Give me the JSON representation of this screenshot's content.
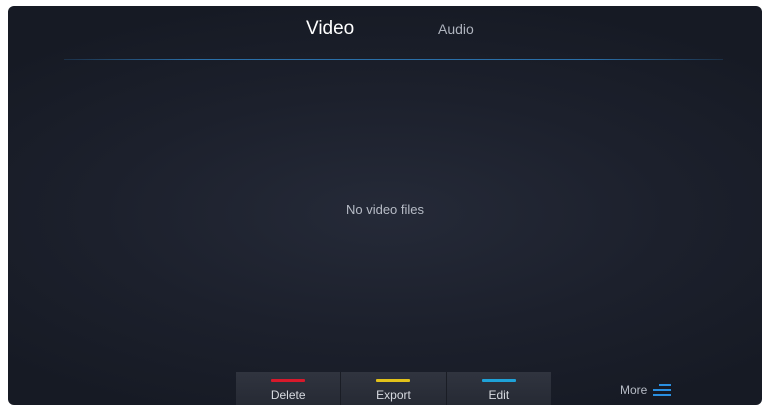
{
  "tabs": {
    "video": "Video",
    "audio": "Audio",
    "active": "Video"
  },
  "content": {
    "empty_message": "No video files"
  },
  "bottom_bar": {
    "buttons": [
      {
        "label": "Delete",
        "color": "#d8192b"
      },
      {
        "label": "Export",
        "color": "#e2c21a"
      },
      {
        "label": "Edit",
        "color": "#1ea2d8"
      }
    ],
    "more": {
      "label": "More",
      "icon": "menu-lines-icon",
      "icon_color": "#2a8fe0"
    }
  },
  "colors": {
    "background": "#1c202c",
    "divider": "#2a6fa8"
  }
}
